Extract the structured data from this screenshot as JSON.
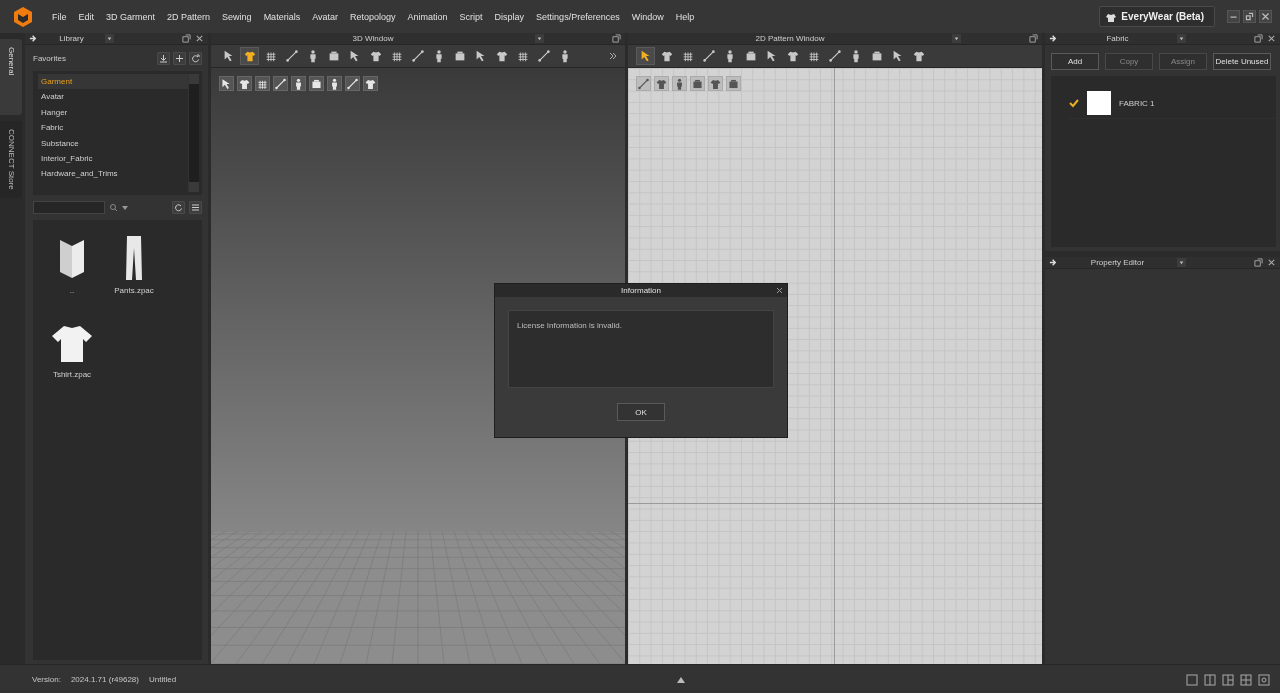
{
  "menu": [
    "File",
    "Edit",
    "3D Garment",
    "2D Pattern",
    "Sewing",
    "Materials",
    "Avatar",
    "Retopology",
    "Animation",
    "Script",
    "Display",
    "Settings/Preferences",
    "Window",
    "Help"
  ],
  "workspace": {
    "label": "EveryWear (Beta)"
  },
  "side_tabs": [
    {
      "label": "General",
      "selected": true
    },
    {
      "label": "CONNECT Store",
      "selected": false
    }
  ],
  "library": {
    "title": "Library",
    "favorites": "Favorites",
    "categories": [
      {
        "label": "Garment",
        "selected": true
      },
      {
        "label": "Avatar",
        "selected": false
      },
      {
        "label": "Hanger",
        "selected": false
      },
      {
        "label": "Fabric",
        "selected": false
      },
      {
        "label": "Substance",
        "selected": false
      },
      {
        "label": "Interior_Fabric",
        "selected": false
      },
      {
        "label": "Hardware_and_Trims",
        "selected": false
      }
    ],
    "files": [
      {
        "name": "..",
        "kind": "folder"
      },
      {
        "name": "Pants.zpac",
        "kind": "pants"
      },
      {
        "name": "Tshirt.zpac",
        "kind": "tshirt"
      }
    ]
  },
  "window_3d": {
    "title": "3D Window",
    "tools": [
      {
        "selected": false
      },
      {
        "selected": true
      },
      {
        "selected": false
      },
      {
        "selected": false
      },
      {
        "selected": false
      },
      {
        "selected": false
      },
      {
        "selected": false
      },
      {
        "selected": false
      },
      {
        "selected": false
      },
      {
        "selected": false
      },
      {
        "selected": false
      },
      {
        "selected": false
      },
      {
        "selected": false
      },
      {
        "selected": false
      },
      {
        "selected": false
      },
      {
        "selected": false
      },
      {
        "selected": false
      }
    ]
  },
  "window_2d": {
    "title": "2D Pattern Window",
    "tools": [
      {
        "selected": true
      },
      {
        "selected": false
      },
      {
        "selected": false
      },
      {
        "selected": false
      },
      {
        "selected": false
      },
      {
        "selected": false
      },
      {
        "selected": false
      },
      {
        "selected": false
      },
      {
        "selected": false
      },
      {
        "selected": false
      },
      {
        "selected": false
      },
      {
        "selected": false
      },
      {
        "selected": false
      },
      {
        "selected": false
      }
    ]
  },
  "fabric": {
    "title": "Fabric",
    "buttons": [
      {
        "label": "Add",
        "disabled": false
      },
      {
        "label": "Copy",
        "disabled": true
      },
      {
        "label": "Assign",
        "disabled": true
      },
      {
        "label": "Delete Unused",
        "disabled": false
      }
    ],
    "items": [
      {
        "name": "FABRIC 1",
        "checked": true
      }
    ]
  },
  "property_editor": {
    "title": "Property Editor"
  },
  "status_bar": {
    "version_label": "Version:",
    "version": "2024.1.71 (r49628)",
    "file": "Untitled"
  },
  "dialog": {
    "title": "Information",
    "message": "License Information is invalid.",
    "button": "OK"
  }
}
